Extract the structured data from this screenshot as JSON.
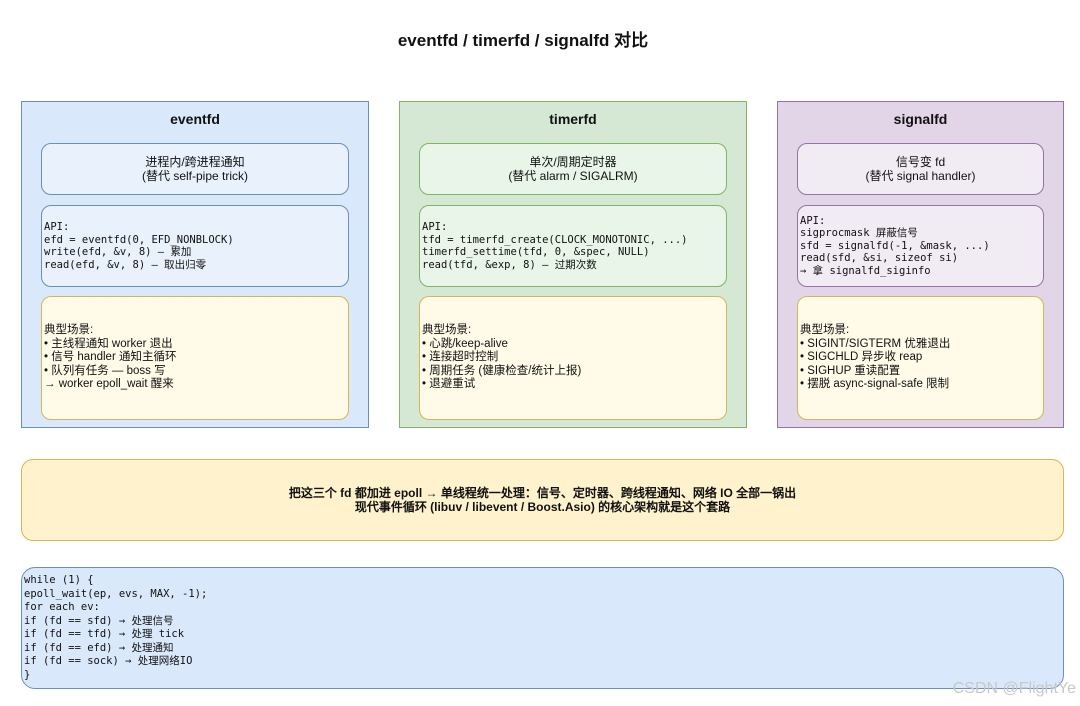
{
  "title": "eventfd / timerfd / signalfd 对比",
  "panels": [
    {
      "name": "eventfd",
      "desc": [
        "进程内/跨进程通知",
        "(替代 self-pipe trick)"
      ],
      "api": [
        "API:",
        "efd = eventfd(0, EFD_NONBLOCK)",
        "write(efd, &v, 8) — 累加",
        "read(efd, &v, 8) — 取出归零"
      ],
      "scenes": [
        "典型场景:",
        "• 主线程通知 worker 退出",
        "• 信号 handler 通知主循环",
        "• 队列有任务 — boss 写",
        "→ worker epoll_wait 醒来"
      ]
    },
    {
      "name": "timerfd",
      "desc": [
        "单次/周期定时器",
        "(替代 alarm / SIGALRM)"
      ],
      "api": [
        "API:",
        "tfd = timerfd_create(CLOCK_MONOTONIC, ...)",
        "timerfd_settime(tfd, 0, &spec, NULL)",
        "read(tfd, &exp, 8) — 过期次数"
      ],
      "scenes": [
        "典型场景:",
        "• 心跳/keep-alive",
        "• 连接超时控制",
        "• 周期任务 (健康检查/统计上报)",
        "• 退避重试"
      ]
    },
    {
      "name": "signalfd",
      "desc": [
        "信号变 fd",
        "(替代 signal handler)"
      ],
      "api": [
        "API:",
        "sigprocmask 屏蔽信号",
        "sfd = signalfd(-1, &mask, ...)",
        "read(sfd, &si, sizeof si)",
        "→ 拿 signalfd_siginfo"
      ],
      "scenes": [
        "典型场景:",
        "• SIGINT/SIGTERM 优雅退出",
        "• SIGCHLD 异步收 reap",
        "• SIGHUP 重读配置",
        "• 摆脱 async-signal-safe 限制"
      ]
    }
  ],
  "banner": [
    "把这三个 fd 都加进 epoll → 单线程统一处理：信号、定时器、跨线程通知、网络 IO 全部一锅出",
    "现代事件循环 (libuv / libevent / Boost.Asio) 的核心架构就是这个套路"
  ],
  "loop": [
    "while (1) {",
    "epoll_wait(ep, evs, MAX, -1);",
    "for each ev:",
    "if (fd == sfd) → 处理信号",
    "if (fd == tfd) → 处理 tick",
    "if (fd == efd) → 处理通知",
    "if (fd == sock) → 处理网络IO",
    "}"
  ],
  "watermark": "CSDN @FlightYe"
}
